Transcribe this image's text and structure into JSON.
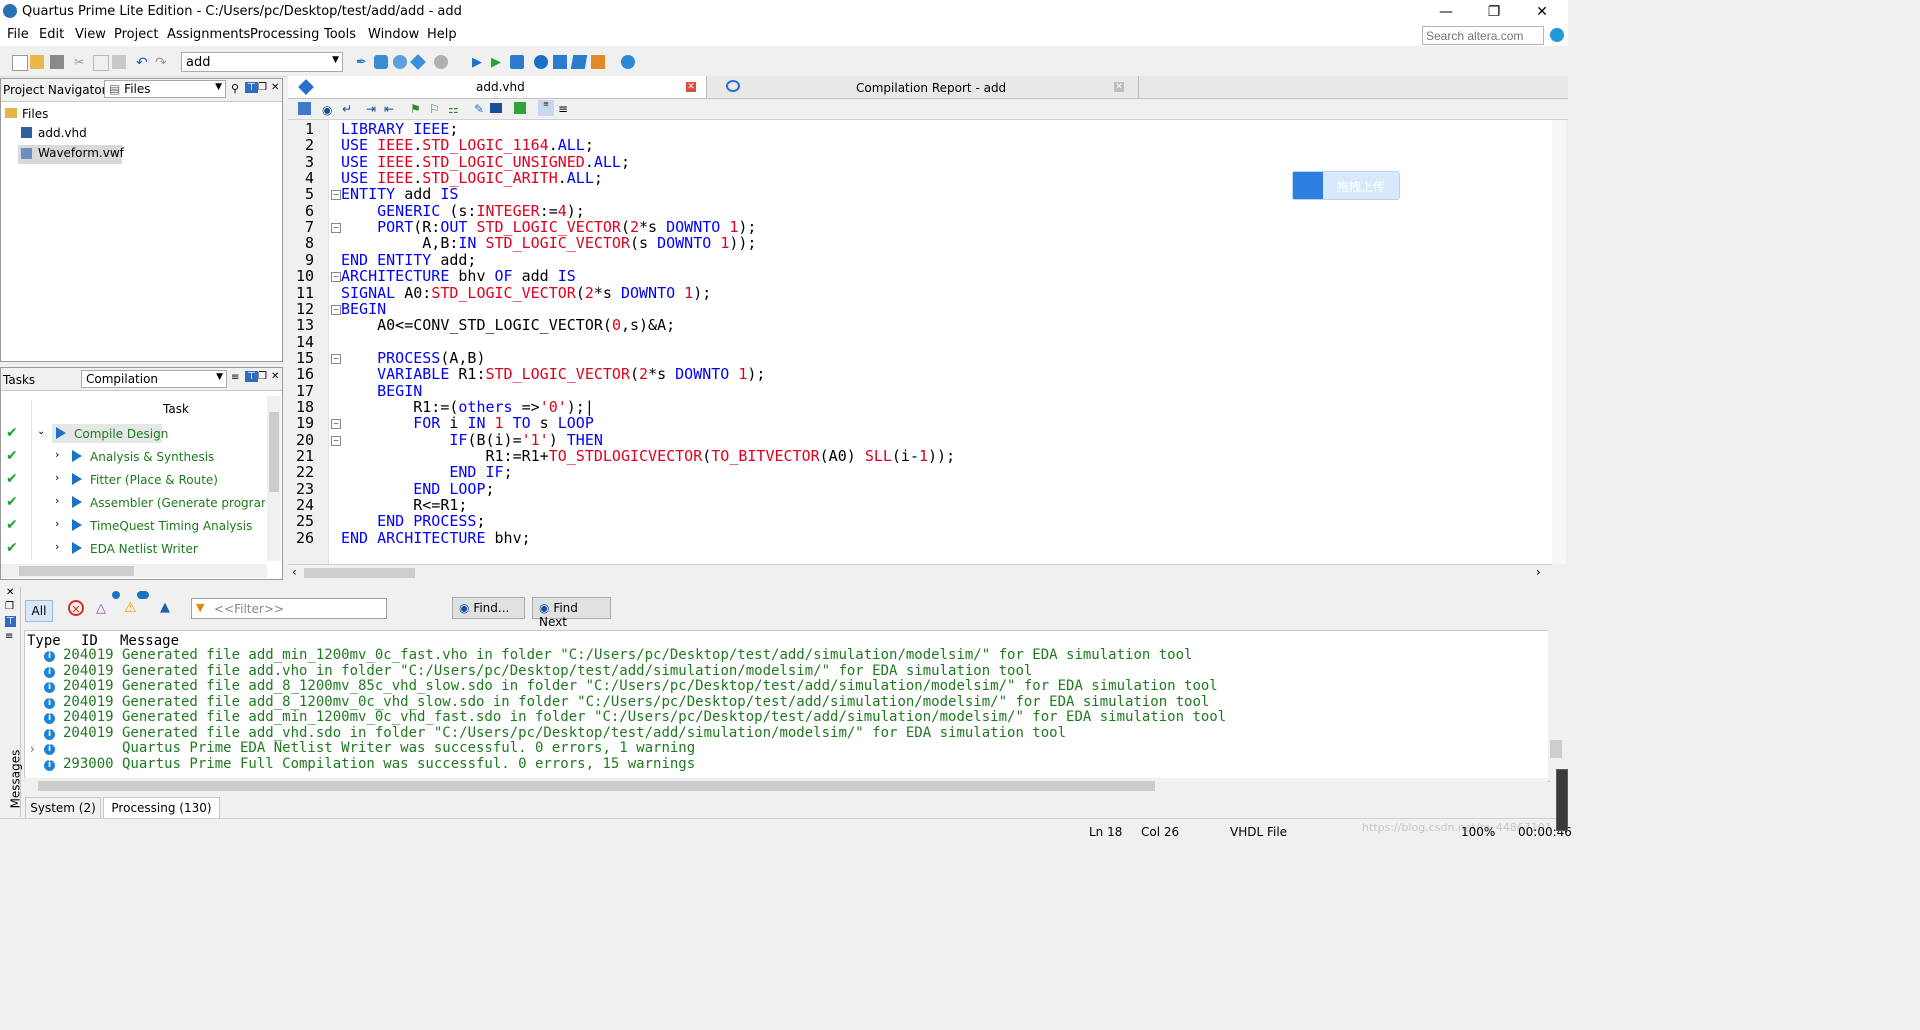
{
  "window": {
    "title": "Quartus Prime Lite Edition - C:/Users/pc/Desktop/test/add/add - add"
  },
  "menu": [
    "File",
    "Edit",
    "View",
    "Project",
    "Assignments",
    "Processing",
    "Tools",
    "Window",
    "Help"
  ],
  "search": {
    "placeholder": "Search altera.com"
  },
  "toolbar": {
    "entity": "add"
  },
  "project_navigator": {
    "title": "Project Navigator",
    "view": "Files",
    "root": "Files",
    "files": [
      "add.vhd",
      "Waveform.vwf"
    ]
  },
  "tasks": {
    "title": "Tasks",
    "flow": "Compilation",
    "column": "Task",
    "items": [
      "Compile Design",
      "Analysis & Synthesis",
      "Fitter (Place & Route)",
      "Assembler (Generate programn",
      "TimeQuest Timing Analysis",
      "EDA Netlist Writer"
    ]
  },
  "editor": {
    "tabs": [
      "add.vhd",
      "Compilation Report - add"
    ],
    "line_numbers": [
      "1",
      "2",
      "3",
      "4",
      "5",
      "6",
      "7",
      "8",
      "9",
      "10",
      "11",
      "12",
      "13",
      "14",
      "15",
      "16",
      "17",
      "18",
      "19",
      "20",
      "21",
      "22",
      "23",
      "24",
      "25",
      "26"
    ],
    "upload_badge": "拖拽上传"
  },
  "messages": {
    "filters": {
      "all": "All",
      "filter_placeholder": "<<Filter>>",
      "find": "Find...",
      "find_next": "Find Next"
    },
    "columns": [
      "Type",
      "ID",
      "Message"
    ],
    "rows": [
      "204019 Generated file add_min_1200mv_0c_fast.vho in folder \"C:/Users/pc/Desktop/test/add/simulation/modelsim/\" for EDA simulation tool",
      "204019 Generated file add.vho in folder \"C:/Users/pc/Desktop/test/add/simulation/modelsim/\" for EDA simulation tool",
      "204019 Generated file add_8_1200mv_85c_vhd_slow.sdo in folder \"C:/Users/pc/Desktop/test/add/simulation/modelsim/\" for EDA simulation tool",
      "204019 Generated file add_8_1200mv_0c_vhd_slow.sdo in folder \"C:/Users/pc/Desktop/test/add/simulation/modelsim/\" for EDA simulation tool",
      "204019 Generated file add_min_1200mv_0c_vhd_fast.sdo in folder \"C:/Users/pc/Desktop/test/add/simulation/modelsim/\" for EDA simulation tool",
      "204019 Generated file add_vhd.sdo in folder \"C:/Users/pc/Desktop/test/add/simulation/modelsim/\" for EDA simulation tool",
      "       Quartus Prime EDA Netlist Writer was successful. 0 errors, 1 warning",
      "293000 Quartus Prime Full Compilation was successful. 0 errors, 15 warnings"
    ],
    "side_label": "Messages",
    "tabs": [
      "System (2)",
      "Processing (130)"
    ]
  },
  "status": {
    "line": "Ln 18",
    "col": "Col 26",
    "filetype": "VHDL File",
    "zoom": "100%",
    "time": "00:00:46",
    "watermark": "https://blog.csdn.net/m_44867101"
  },
  "colors": {
    "keyword": "#0000ff",
    "type": "#e0001b",
    "message": "#1f7a1f",
    "task": "#1b7a1b"
  }
}
